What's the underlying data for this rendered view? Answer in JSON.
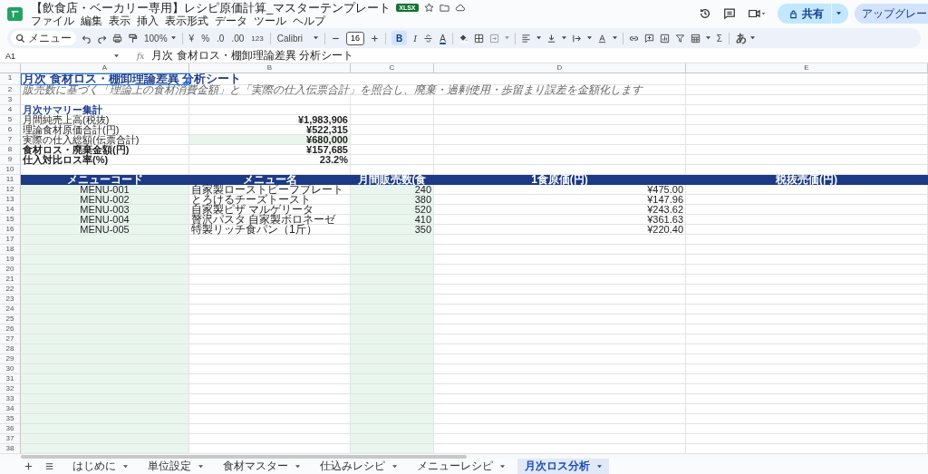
{
  "app": {
    "title": "【飲食店・ベーカリー専用】レシピ原価計算_マスターテンプレート",
    "badge": "XLSX",
    "menu": [
      "ファイル",
      "編集",
      "表示",
      "挿入",
      "表示形式",
      "データ",
      "ツール",
      "ヘルプ"
    ],
    "share": "共有",
    "upgrade": "アップグレー"
  },
  "toolbar": {
    "search": "メニュー",
    "zoom": "100%",
    "currency": "¥",
    "percent": "%",
    "decimal_less": ".0",
    "decimal_more": ".00",
    "number_format": "123",
    "font": "Calibri",
    "font_size": "16",
    "bold": {
      "label": "B",
      "on": true
    },
    "italic": "I",
    "text_color": "A",
    "sum": "Σ",
    "input_tools": "あ"
  },
  "formula_bar": {
    "cell": "A1",
    "fx": "fx",
    "content": "月次 食材ロス・棚卸理論差異 分析シート"
  },
  "sheet": {
    "column_letters": [
      "A",
      "B",
      "C",
      "D",
      "E"
    ],
    "row_numbers": [
      "1",
      "2",
      "3",
      "4",
      "5",
      "6",
      "7",
      "8",
      "9",
      "10",
      "11",
      "12",
      "13",
      "14",
      "15",
      "16",
      "17",
      "18",
      "19",
      "20",
      "21",
      "22",
      "23",
      "24",
      "25",
      "26",
      "27",
      "28",
      "29",
      "30",
      "31",
      "32",
      "33",
      "34",
      "35",
      "36",
      "37",
      "38"
    ],
    "title": {
      "text": "月次 食材ロス・棚卸理論差異 分析シート",
      "selected": true
    },
    "subtitle": "販売数に基づく「理論上の食材消費金額」と「実際の仕入伝票合計」を照合し、廃棄・過剰使用・歩留まり誤差を金額化します",
    "summary": {
      "heading": "月次サマリー集計",
      "items": [
        {
          "label": "月間純売上高(税抜)",
          "value": "¥1,983,906",
          "bold": false,
          "input": false
        },
        {
          "label": "理論食材原価合計(円)",
          "value": "¥522,315",
          "bold": false,
          "input": false
        },
        {
          "label": "実際の仕入総額(伝票合計)",
          "value": "¥680,000",
          "bold": false,
          "input": true
        },
        {
          "label": "食材ロス・廃棄金額(円)",
          "value": "¥157,685",
          "bold": true,
          "input": false
        },
        {
          "label": "仕入対比ロス率(%)",
          "value": "23.2%",
          "bold": true,
          "input": false
        }
      ]
    },
    "table": {
      "columns": [
        {
          "label": "メニューコード",
          "input": true
        },
        {
          "label": "メニュー名",
          "input": false
        },
        {
          "label": "月間販売数(食",
          "input": true
        },
        {
          "label": "1食原価(円)",
          "input": false
        },
        {
          "label": "税抜売価(円)",
          "input": false
        }
      ],
      "rows": [
        {
          "code": "MENU-001",
          "name": "自家製ローストビーフプレート",
          "sold": "240",
          "cost": "¥475.00"
        },
        {
          "code": "MENU-002",
          "name": "とろけるチーズトースト",
          "sold": "380",
          "cost": "¥147.96"
        },
        {
          "code": "MENU-003",
          "name": "自家製ピザ マルゲリータ",
          "sold": "520",
          "cost": "¥243.62"
        },
        {
          "code": "MENU-004",
          "name": "贅沢パスタ 自家製ボロネーゼ",
          "sold": "410",
          "cost": "¥361.63"
        },
        {
          "code": "MENU-005",
          "name": "特製リッチ食パン（1斤）",
          "sold": "350",
          "cost": "¥220.40"
        }
      ]
    }
  },
  "tabs": [
    {
      "label": "はじめに",
      "selected": false
    },
    {
      "label": "単位設定",
      "selected": false
    },
    {
      "label": "食材マスター",
      "selected": false
    },
    {
      "label": "仕込みレシピ",
      "selected": false
    },
    {
      "label": "メニューレシピ",
      "selected": false
    },
    {
      "label": "月次ロス分析",
      "selected": true
    }
  ]
}
